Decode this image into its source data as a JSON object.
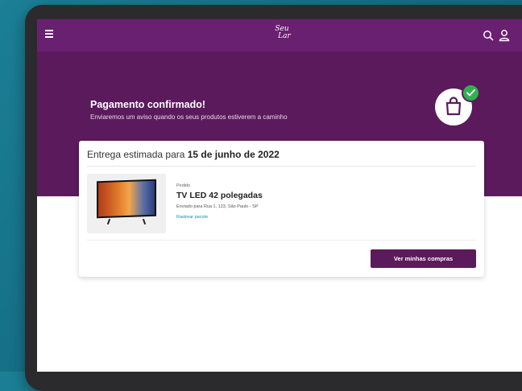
{
  "header": {
    "logo_line1": "Seu",
    "logo_line2": "Lar",
    "menu_icon": "hamburger-icon",
    "search_icon": "search-icon",
    "account_icon": "user-icon"
  },
  "banner": {
    "title": "Pagamento confirmado!",
    "subtitle": "Enviaremos um aviso quando os seus produtos estiverem a caminho",
    "bag_icon": "shopping-bag-icon",
    "check_icon": "check-icon"
  },
  "order": {
    "delivery_prefix": "Entrega estimada para",
    "delivery_date": "15 de junho de 2022",
    "order_label": "Pedido",
    "product_name": "TV LED 42 polegadas",
    "shipping_address": "Enviado para Rua 1, 123, São Paulo - SP",
    "track_link": "Rastrear pacote",
    "cta_label": "Ver minhas compras"
  },
  "colors": {
    "header": "#6a2070",
    "banner": "#5b1a5c",
    "button": "#5b1a5c",
    "success": "#2fb24e",
    "link": "#1a88b5"
  }
}
